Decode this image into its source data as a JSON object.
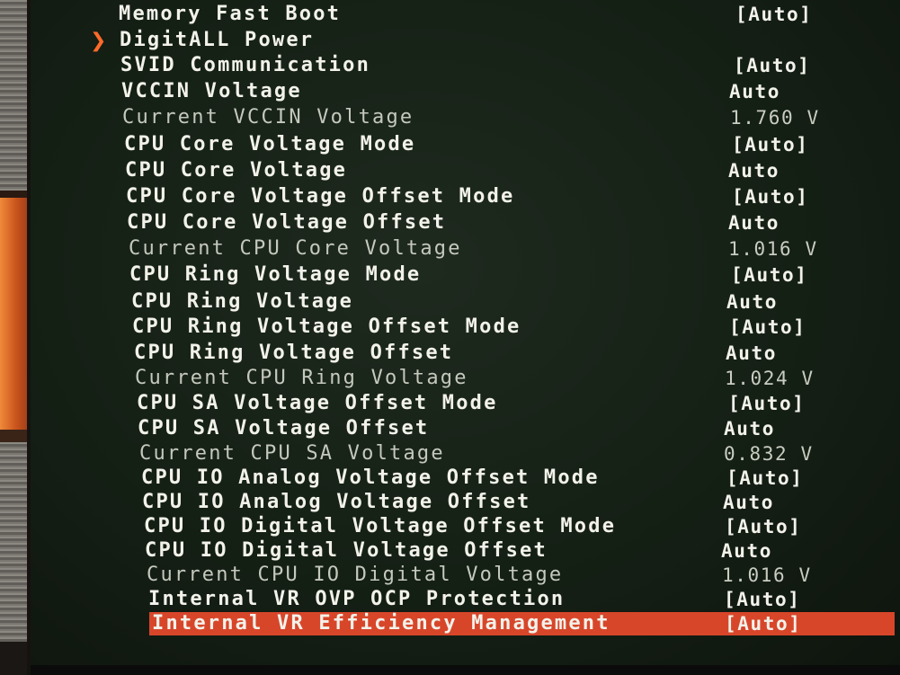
{
  "menu": {
    "items": [
      {
        "label": "Memory Fast Boot",
        "value": "[Auto]"
      },
      {
        "label": "DigitALL Power",
        "value": ""
      },
      {
        "label": "SVID Communication",
        "value": "[Auto]"
      },
      {
        "label": "VCCIN Voltage",
        "value": "Auto"
      },
      {
        "label": "Current VCCIN Voltage",
        "value": "1.760 V"
      },
      {
        "label": "CPU Core Voltage Mode",
        "value": "[Auto]"
      },
      {
        "label": "CPU Core Voltage",
        "value": "Auto"
      },
      {
        "label": "CPU Core Voltage Offset Mode",
        "value": "[Auto]"
      },
      {
        "label": "CPU Core Voltage Offset",
        "value": "Auto"
      },
      {
        "label": "Current CPU Core Voltage",
        "value": "1.016 V"
      },
      {
        "label": "CPU Ring Voltage Mode",
        "value": "[Auto]"
      },
      {
        "label": "CPU Ring Voltage",
        "value": "Auto"
      },
      {
        "label": "CPU Ring Voltage Offset Mode",
        "value": "[Auto]"
      },
      {
        "label": "CPU Ring Voltage Offset",
        "value": "Auto"
      },
      {
        "label": "Current CPU Ring Voltage",
        "value": "1.024 V"
      },
      {
        "label": "CPU SA Voltage Offset Mode",
        "value": "[Auto]"
      },
      {
        "label": "CPU SA Voltage Offset",
        "value": "Auto"
      },
      {
        "label": "Current CPU SA Voltage",
        "value": "0.832 V"
      },
      {
        "label": "CPU IO Analog Voltage Offset Mode",
        "value": "[Auto]"
      },
      {
        "label": "CPU IO Analog Voltage Offset",
        "value": "Auto"
      },
      {
        "label": "CPU IO Digital Voltage Offset Mode",
        "value": "[Auto]"
      },
      {
        "label": "CPU IO Digital Voltage Offset",
        "value": "Auto"
      },
      {
        "label": "Current CPU IO Digital Voltage",
        "value": "1.016 V"
      },
      {
        "label": "Internal VR OVP OCP Protection",
        "value": "[Auto]"
      },
      {
        "label": "Internal VR Efficiency Management",
        "value": "[Auto]"
      }
    ]
  },
  "icons": {
    "submenu_pointer": "chevron-right-icon"
  },
  "colors": {
    "selection": "#d8462a",
    "pointer": "#ff6a2a",
    "background": "#152015",
    "text": "#f2f2ea",
    "readonly_text": "#c5c8bd"
  }
}
